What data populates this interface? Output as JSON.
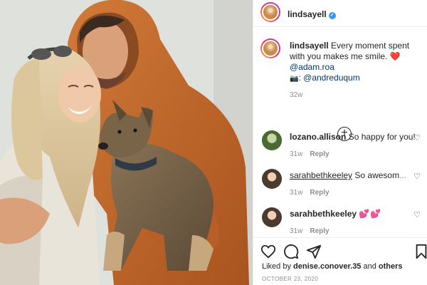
{
  "post": {
    "author": "lindsayell",
    "caption_username": "lindsayell",
    "caption_text": "Every moment spent with you makes me smile.",
    "caption_heart": "❤️",
    "caption_mention_1": "@adam.roa",
    "caption_camera": "📷",
    "caption_colon": ":",
    "caption_mention_2": "@andreduqum",
    "caption_time": "32w",
    "liked_by_prefix": "Liked by",
    "liked_by_user": "denise.conover.35",
    "liked_by_and": "and",
    "liked_by_others": "others",
    "date": "OCTOBER 23, 2020"
  },
  "comments": [
    {
      "username": "lozano.allison",
      "text": "So happy for you!",
      "time": "31w",
      "reply": "Reply"
    },
    {
      "username": "sarahbethkeeley",
      "text": "So awesom",
      "suffix": "...",
      "time": "31w",
      "reply": "Reply"
    },
    {
      "username": "sarahbethkeeley",
      "text": "💕💕",
      "time": "31w",
      "reply": "Reply"
    }
  ],
  "icons": {
    "verified": "verified-badge",
    "more": "more-options-icon",
    "load_more": "load-more-comments-icon",
    "like": "heart-icon",
    "comment": "comment-icon",
    "share": "share-icon",
    "save": "bookmark-icon"
  },
  "colors": {
    "verified": "#3897f0",
    "mention": "#00376b",
    "muted": "#8e8e8e",
    "hoodie": "#c46a2e"
  }
}
